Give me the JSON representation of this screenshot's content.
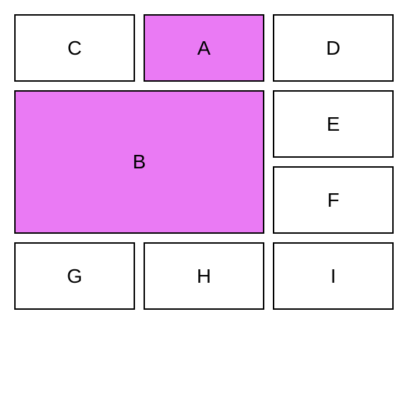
{
  "highlight_color": "#ea7af4",
  "cells": {
    "C": {
      "label": "C",
      "highlight": false
    },
    "A": {
      "label": "A",
      "highlight": true
    },
    "D": {
      "label": "D",
      "highlight": false
    },
    "B": {
      "label": "B",
      "highlight": true
    },
    "E": {
      "label": "E",
      "highlight": false
    },
    "F": {
      "label": "F",
      "highlight": false
    },
    "G": {
      "label": "G",
      "highlight": false
    },
    "H": {
      "label": "H",
      "highlight": false
    },
    "I": {
      "label": "I",
      "highlight": false
    }
  }
}
